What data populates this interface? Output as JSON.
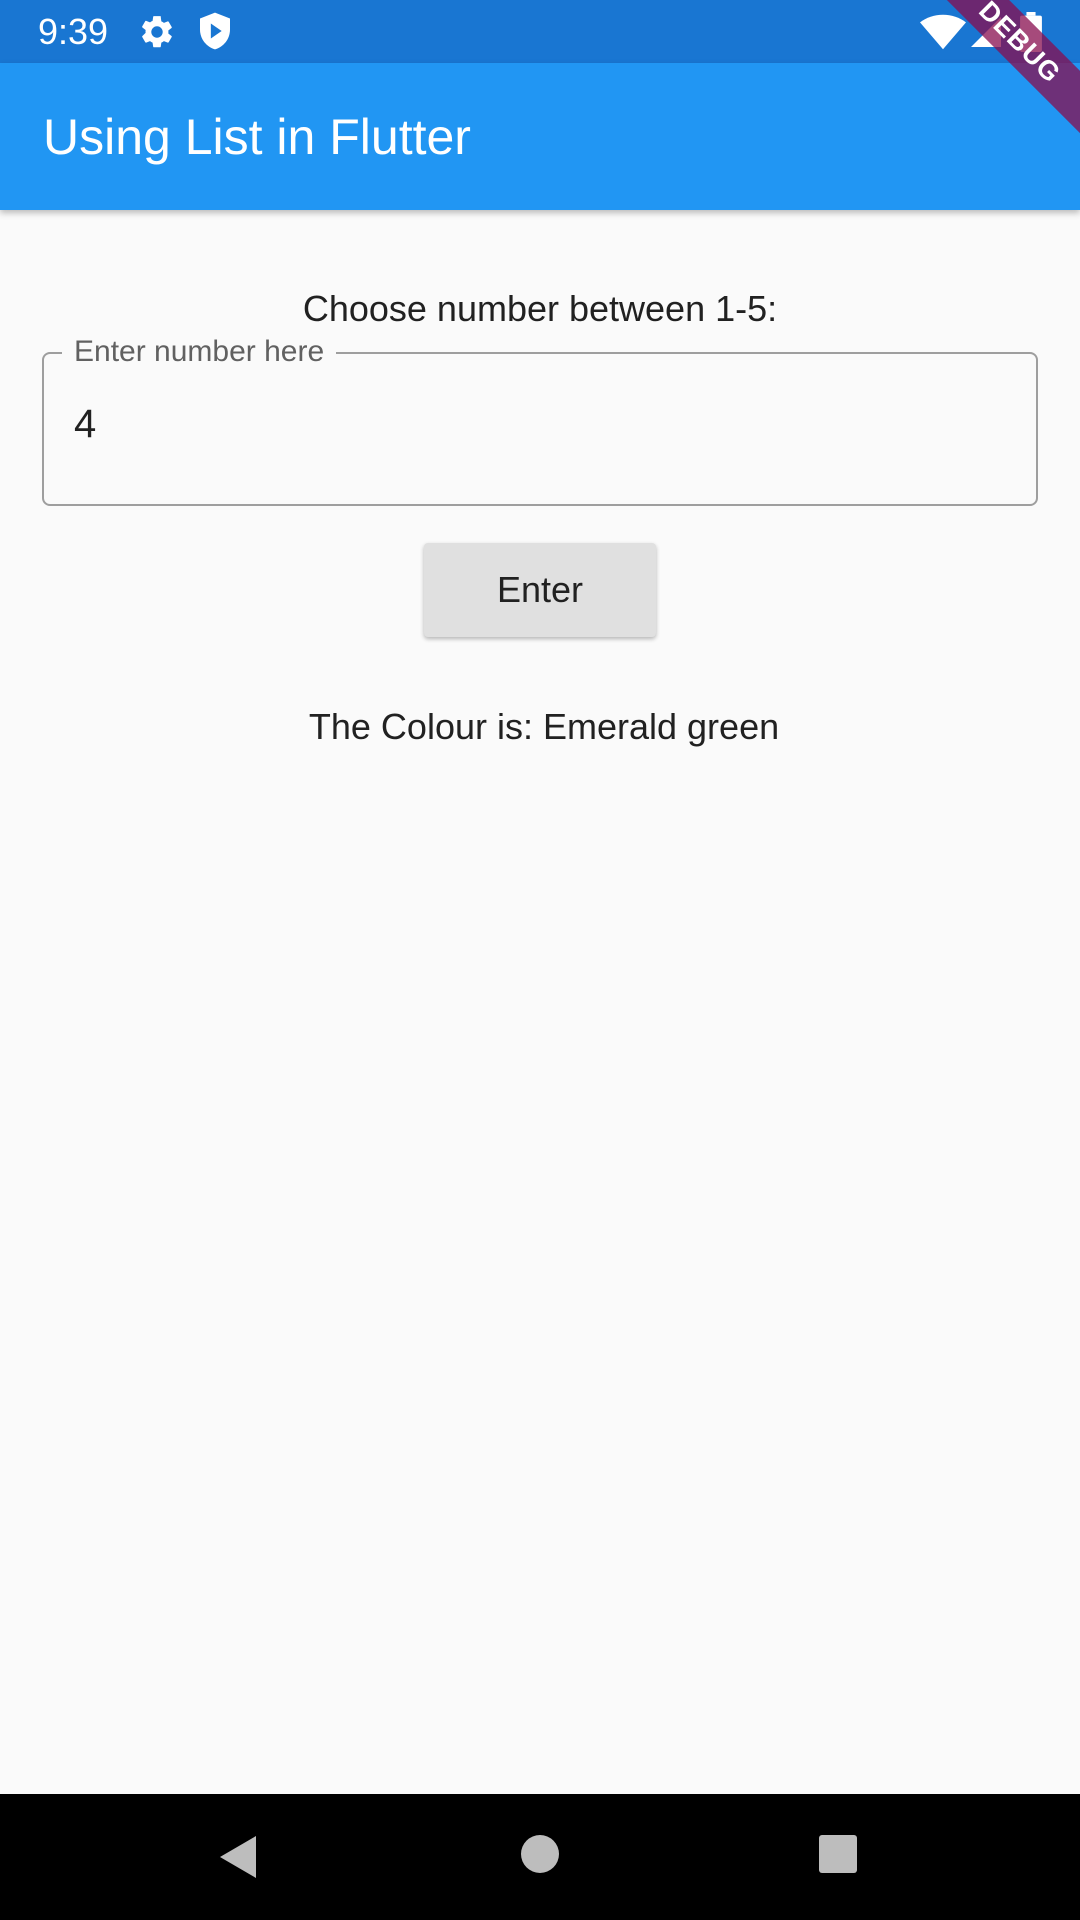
{
  "status_bar": {
    "time": "9:39",
    "icons": [
      "gear-icon",
      "shield-play-icon",
      "wifi-icon",
      "cell-signal-icon",
      "battery-icon"
    ],
    "background": "#1976d2"
  },
  "debug_banner": {
    "label": "DEBUG",
    "color": "#880e4f"
  },
  "app_bar": {
    "title": "Using List in Flutter",
    "background": "#2196f3"
  },
  "main": {
    "prompt": "Choose number between 1-5:",
    "input": {
      "label": "Enter number here",
      "value": "4"
    },
    "enter_button": {
      "label": "Enter"
    },
    "result": "The Colour is: Emerald green"
  },
  "nav_bar": {
    "icons": [
      "back-icon",
      "home-icon",
      "recent-apps-icon"
    ]
  }
}
